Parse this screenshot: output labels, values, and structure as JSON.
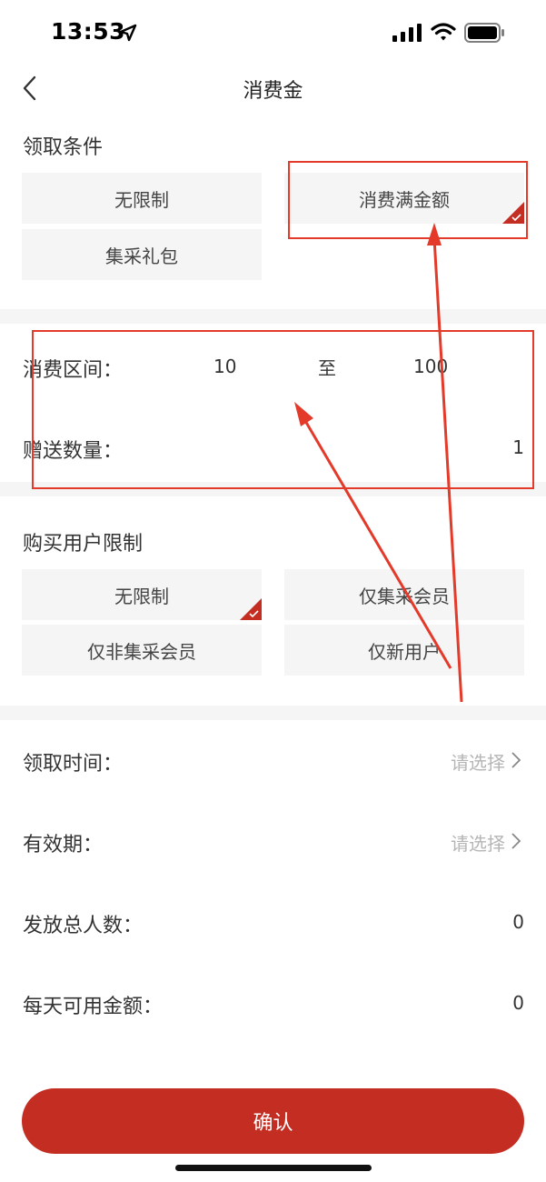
{
  "status": {
    "time": "13:53"
  },
  "nav": {
    "title": "消费金"
  },
  "claim_condition": {
    "title": "领取条件",
    "options": [
      {
        "label": "无限制",
        "selected": false
      },
      {
        "label": "消费满金额",
        "selected": true
      },
      {
        "label": "集采礼包",
        "selected": false
      }
    ]
  },
  "spend_range": {
    "label": "消费区间：",
    "min": "10",
    "separator": "至",
    "max": "100"
  },
  "gift_quantity": {
    "label": "赠送数量：",
    "value": "1"
  },
  "buyer_limit": {
    "title": "购买用户限制",
    "options": [
      {
        "label": "无限制",
        "selected": true
      },
      {
        "label": "仅集采会员",
        "selected": false
      },
      {
        "label": "仅非集采会员",
        "selected": false
      },
      {
        "label": "仅新用户",
        "selected": false
      }
    ]
  },
  "fields": {
    "claim_time": {
      "label": "领取时间：",
      "placeholder": "请选择"
    },
    "validity": {
      "label": "有效期：",
      "placeholder": "请选择"
    },
    "total_recipients": {
      "label": "发放总人数：",
      "value": "0"
    },
    "daily_amount": {
      "label": "每天可用金额：",
      "value": "0"
    }
  },
  "confirm": {
    "label": "确认"
  },
  "colors": {
    "accent": "#c42d22",
    "annotation": "#e33a2a",
    "option_bg": "#f5f5f5"
  }
}
